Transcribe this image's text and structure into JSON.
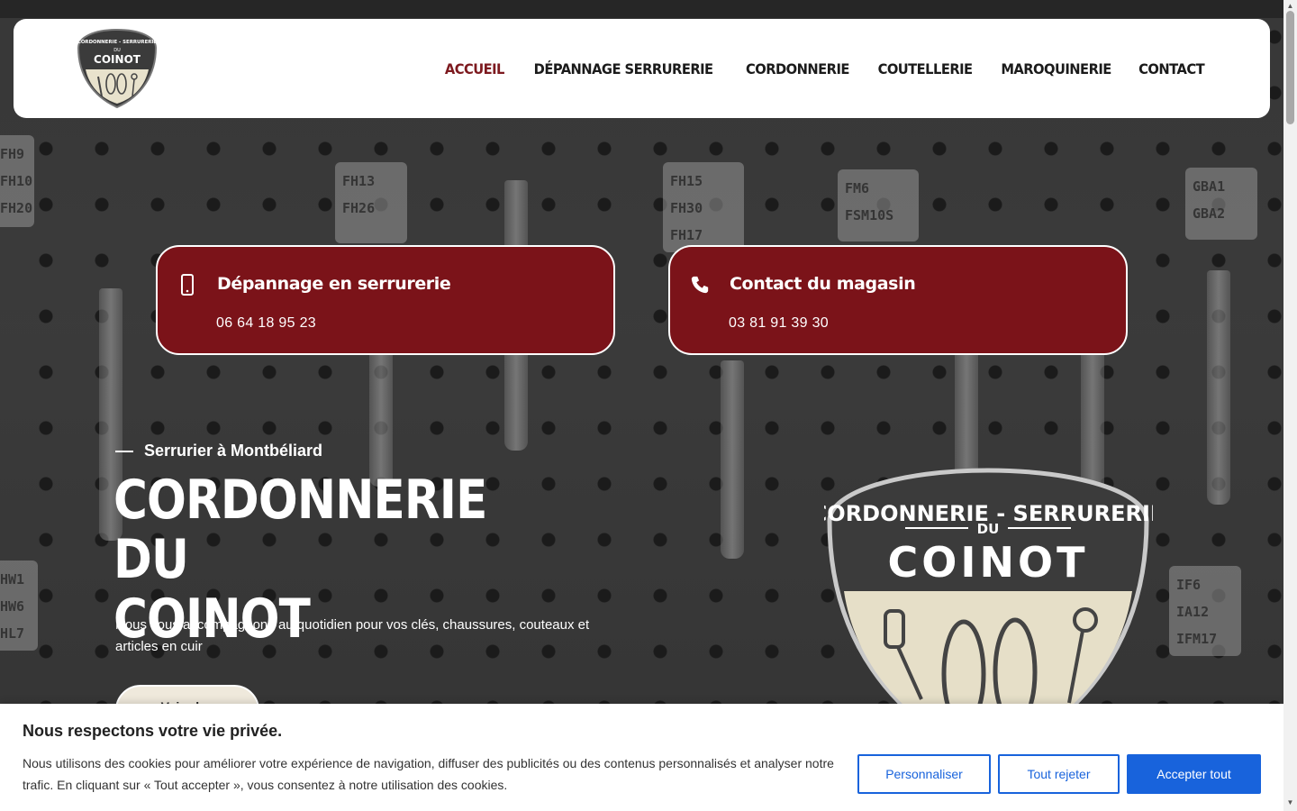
{
  "nav": {
    "items": [
      {
        "label": "ACCUEIL",
        "active": true
      },
      {
        "label": "DÉPANNAGE SERRURERIE",
        "active": false
      },
      {
        "label": "CORDONNERIE",
        "active": false
      },
      {
        "label": "COUTELLERIE",
        "active": false
      },
      {
        "label": "MAROQUINERIE",
        "active": false
      },
      {
        "label": "CONTACT",
        "active": false
      }
    ]
  },
  "logo": {
    "arc_text": "CORDONNERIE - SERRURERIE",
    "du": "DU",
    "name": "COINOT"
  },
  "cards": [
    {
      "icon": "smartphone-icon",
      "title": "Dépannage en serrurerie",
      "phone": "06 64 18 95 23"
    },
    {
      "icon": "phone-icon",
      "title": "Contact du magasin",
      "phone": "03 81 91 39 30"
    }
  ],
  "hero": {
    "eyebrow": "Serrurier à Montbéliard",
    "title_line1": "CORDONNERIE DU",
    "title_line2": "COINOT",
    "subtitle": "Nous vous accompagnons au quotidien pour vos clés, chaussures, couteaux et articles en cuir",
    "button_label": "Voir plus"
  },
  "cookie": {
    "title": "Nous respectons votre vie privée.",
    "text": "Nous utilisons des cookies pour améliorer votre expérience de navigation, diffuser des publicités ou des contenus personnalisés et analyser notre trafic. En cliquant sur « Tout accepter », vous consentez à notre utilisation des cookies.",
    "customize_label": "Personnaliser",
    "reject_label": "Tout rejeter",
    "accept_label": "Accepter tout"
  },
  "background_tags": {
    "left_top": [
      "FH9",
      "FH10",
      "FH20"
    ],
    "tag1": [
      "FH13",
      "FH26"
    ],
    "tag2": [
      "FH15",
      "FH30",
      "FH17"
    ],
    "tag3": [
      "FM6",
      "FSM10S"
    ],
    "tag4": [
      "GBA1",
      "GBA2"
    ],
    "left_bottom": [
      "HW1",
      "HW6",
      "HL7"
    ],
    "right_bottom": [
      "IF6",
      "IA12",
      "IFM17"
    ]
  },
  "colors": {
    "brand_red": "#7b1319",
    "active_nav": "#7d1a1f",
    "cookie_blue": "#1863dc"
  }
}
